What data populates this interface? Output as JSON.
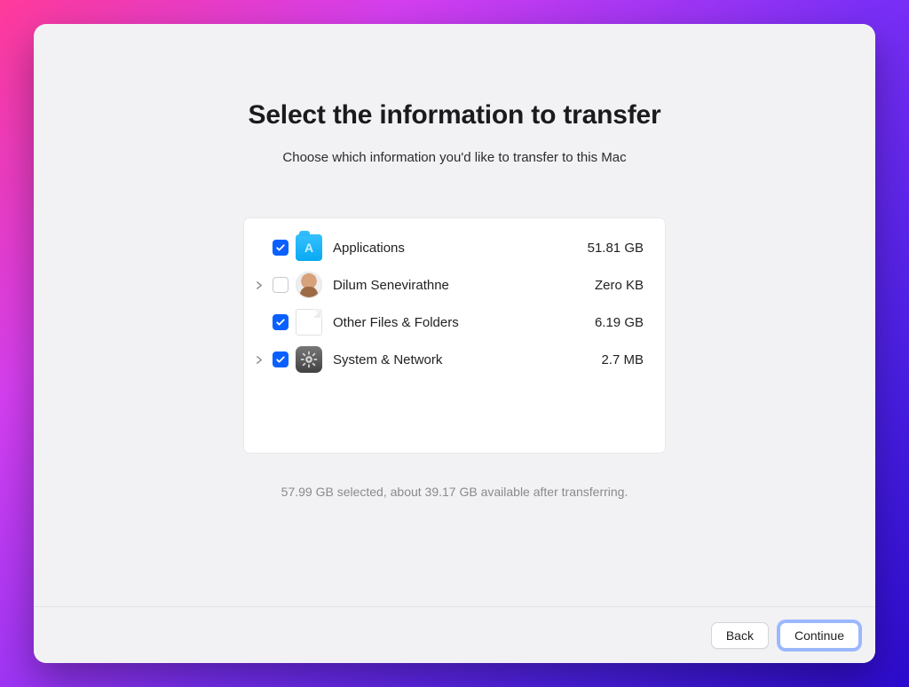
{
  "title": "Select the information to transfer",
  "subtitle": "Choose which information you'd like to transfer to this Mac",
  "items": [
    {
      "label": "Applications",
      "size": "51.81 GB",
      "checked": true,
      "expandable": false,
      "icon": "apps-folder-icon"
    },
    {
      "label": "Dilum Senevirathne",
      "size": "Zero KB",
      "checked": false,
      "expandable": true,
      "icon": "user-avatar-icon"
    },
    {
      "label": "Other Files & Folders",
      "size": "6.19 GB",
      "checked": true,
      "expandable": false,
      "icon": "document-icon"
    },
    {
      "label": "System & Network",
      "size": "2.7 MB",
      "checked": true,
      "expandable": true,
      "icon": "system-prefs-icon"
    }
  ],
  "summary": "57.99 GB selected, about 39.17 GB available after transferring.",
  "buttons": {
    "back": "Back",
    "continue": "Continue"
  }
}
